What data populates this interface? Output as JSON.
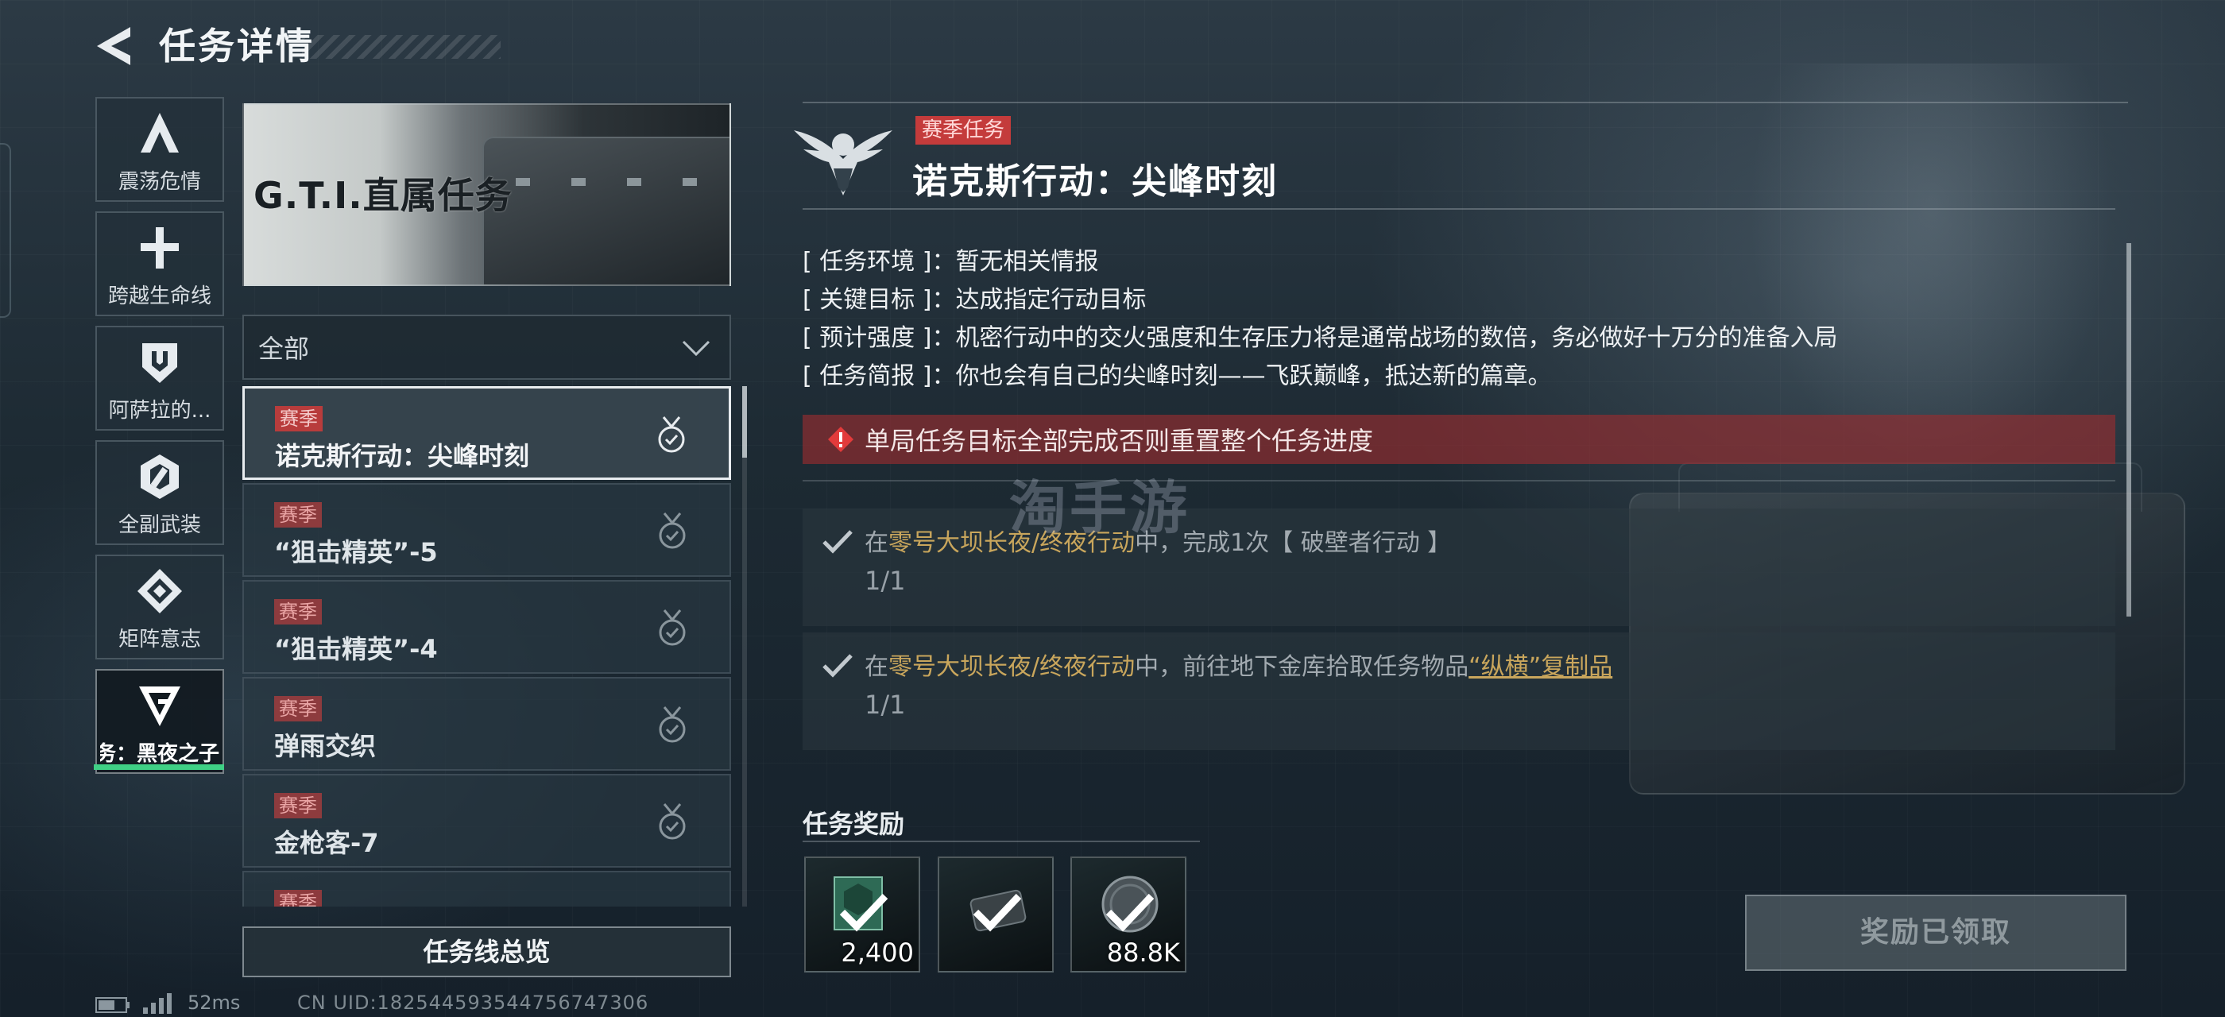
{
  "header": {
    "title": "任务详情"
  },
  "categories": [
    {
      "label": "震荡危情",
      "icon": "a-shape-icon"
    },
    {
      "label": "跨越生命线",
      "icon": "cross-icon"
    },
    {
      "label": "阿萨拉的...",
      "icon": "shield-icon"
    },
    {
      "label": "全副武装",
      "icon": "hex-emblem-icon"
    },
    {
      "label": "矩阵意志",
      "icon": "diamond-emblem-icon"
    },
    {
      "label": "务：黑夜之子",
      "icon": "g-emblem-icon",
      "active": true
    }
  ],
  "banner": {
    "title": "G.T.I.直属任务"
  },
  "filter": {
    "selected": "全部"
  },
  "missions": [
    {
      "tag": "赛季",
      "name": "诺克斯行动：尖峰时刻",
      "active": true
    },
    {
      "tag": "赛季",
      "name": "“狙击精英”-5"
    },
    {
      "tag": "赛季",
      "name": "“狙击精英”-4"
    },
    {
      "tag": "赛季",
      "name": "弹雨交织"
    },
    {
      "tag": "赛季",
      "name": "金枪客-7"
    },
    {
      "tag": "赛季",
      "name": ""
    }
  ],
  "overview_button": "任务线总览",
  "status": {
    "ping": "52ms",
    "uid": "CN UID:1825445935447567473​06"
  },
  "detail": {
    "badge": "赛季任务",
    "title": "诺克斯行动：尖峰时刻",
    "info": [
      {
        "label": "[ 任务环境 ]：",
        "value": "暂无相关情报"
      },
      {
        "label": "[ 关键目标 ]：",
        "value": "达成指定行动目标"
      },
      {
        "label": "[ 预计强度 ]：",
        "value": "机密行动中的交火强度和生存压力将是通常战场的数倍，务必做好十万分的准备入局"
      },
      {
        "label": "[ 任务简报 ]：",
        "value": "你也会有自己的尖峰时刻——飞跃巅峰，抵达新的篇章。"
      }
    ],
    "warning": "单局任务目标全部完成否则重置整个任务进度",
    "objectives": [
      {
        "pre": "在",
        "place": "零号大坝长夜/终夜行动",
        "mid": "中，完成1次【 破壁者行动 】",
        "item": "",
        "progress": "1/1"
      },
      {
        "pre": "在",
        "place": "零号大坝长夜/终夜行动",
        "mid": "中，前往地下金库拾取任务物品",
        "item": "“纵横”复制品",
        "progress": "1/1"
      }
    ],
    "reward_label": "任务奖励",
    "rewards": [
      {
        "amount": "2,400",
        "icon": "xp-card-icon"
      },
      {
        "amount": "",
        "icon": "device-item-icon"
      },
      {
        "amount": "88.8K",
        "icon": "coin-icon"
      }
    ],
    "claimed_button": "奖励已领取"
  },
  "watermark": "淘手游",
  "colors": {
    "accent_green": "#3fd085",
    "season_red": "#c43b3b",
    "highlight_gold": "#c9a65c",
    "warning_bg": "#962d30"
  }
}
